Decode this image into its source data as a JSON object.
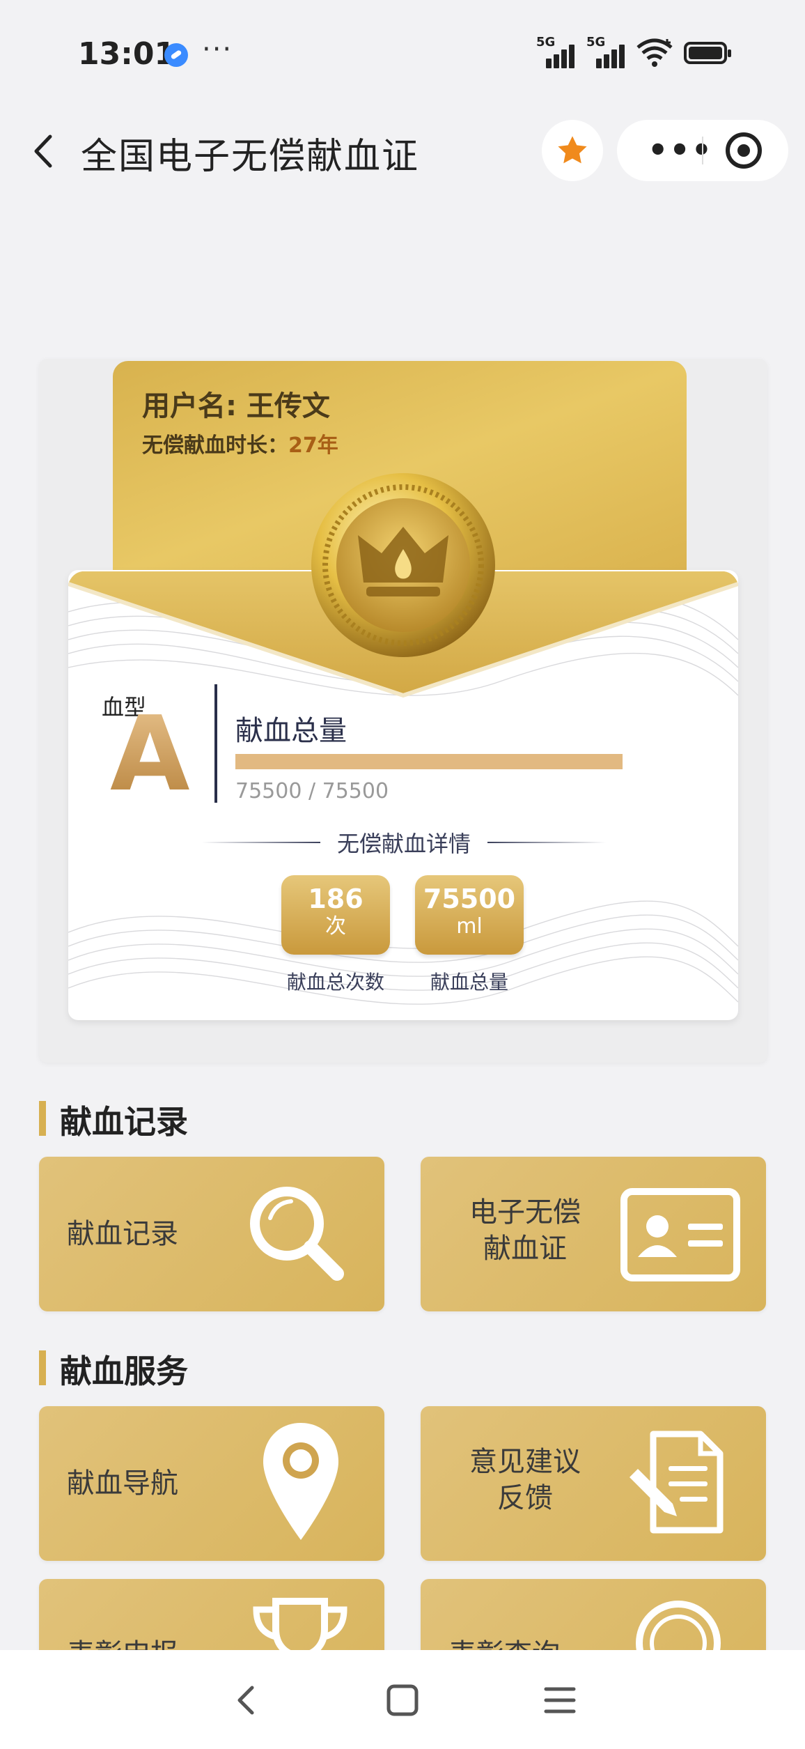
{
  "status_bar": {
    "time": "13:01",
    "more": "···",
    "network_1": "5G",
    "network_2": "5G"
  },
  "header": {
    "title": "全国电子无偿献血证"
  },
  "card": {
    "user_name": "用户名: 王传文",
    "duration_label": "无偿献血时长：",
    "duration_value": "27年",
    "blood_type_label": "血型",
    "blood_type": "A",
    "total_title": "献血总量",
    "progress_text": "75500 / 75500",
    "progress_fraction": 1.0,
    "details_title": "无偿献血详情",
    "stats": [
      {
        "value": "186",
        "unit": "次",
        "label": "献血总次数"
      },
      {
        "value": "75500",
        "unit": "ml",
        "label": "献血总量"
      }
    ]
  },
  "sections": [
    {
      "title": "献血记录",
      "tiles": [
        {
          "label": "献血记录",
          "icon": "magnifier-icon"
        },
        {
          "label_line1": "电子无偿",
          "label_line2": "献血证",
          "icon": "id-card-icon"
        }
      ]
    },
    {
      "title": "献血服务",
      "tiles": [
        {
          "label": "献血导航",
          "icon": "location-pin-icon"
        },
        {
          "label_line1": "意见建议",
          "label_line2": "反馈",
          "icon": "document-edit-icon"
        }
      ]
    }
  ],
  "partial_tiles": [
    {
      "label": "表彰申报",
      "icon": "trophy-icon"
    },
    {
      "label": "表彰查询",
      "icon": "medal-icon"
    }
  ],
  "colors": {
    "gold": "#d8b45c",
    "accent_star": "#f08a1c",
    "navy": "#2a2f4a"
  }
}
